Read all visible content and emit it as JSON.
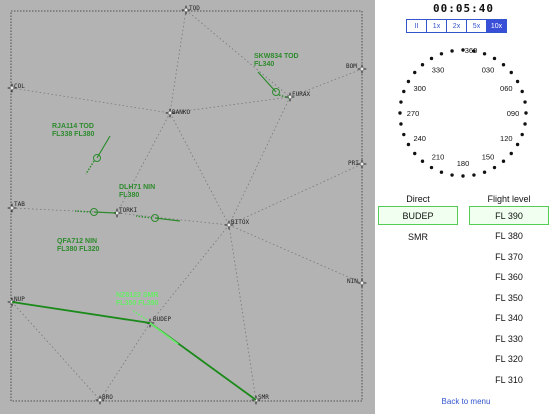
{
  "clock": "00:05:40",
  "speed_options": [
    "II",
    "1x",
    "2x",
    "5x",
    "10x"
  ],
  "speed_active": "10x",
  "compass_labels": [
    "360",
    "030",
    "060",
    "090",
    "120",
    "150",
    "180",
    "210",
    "240",
    "270",
    "300",
    "330"
  ],
  "waypoints": [
    "TOD",
    "COL",
    "BOM",
    "FURAX",
    "BANKO",
    "PRI",
    "TAB",
    "TORKI",
    "BITOX",
    "NIN",
    "NUP",
    "BUDEP",
    "BRO",
    "SMR"
  ],
  "aircraft": [
    {
      "callsign": "SKW834 TOD",
      "level": "FL340"
    },
    {
      "callsign": "RJA114 TOD",
      "level": "FL338 FL380"
    },
    {
      "callsign": "DLH71 NIN",
      "level": "FL380"
    },
    {
      "callsign": "QFA712 NIN",
      "level": "FL380 FL320"
    },
    {
      "callsign": "NZ8123 SMR",
      "level": "FL350 FL390"
    }
  ],
  "direct": {
    "header": "Direct",
    "options": [
      "BUDEP",
      "SMR"
    ],
    "selected": "BUDEP"
  },
  "flight_level": {
    "header": "Flight level",
    "options": [
      "FL 390",
      "FL 380",
      "FL 370",
      "FL 360",
      "FL 350",
      "FL 340",
      "FL 330",
      "FL 320",
      "FL 310"
    ],
    "selected": "FL 390"
  },
  "back_label": "Back to menu",
  "colors": {
    "radar_bg": "#b3b3b3",
    "aircraft": "#2e8b2e",
    "aircraft_selected": "#66ee66",
    "accent": "#3a4fd8"
  }
}
